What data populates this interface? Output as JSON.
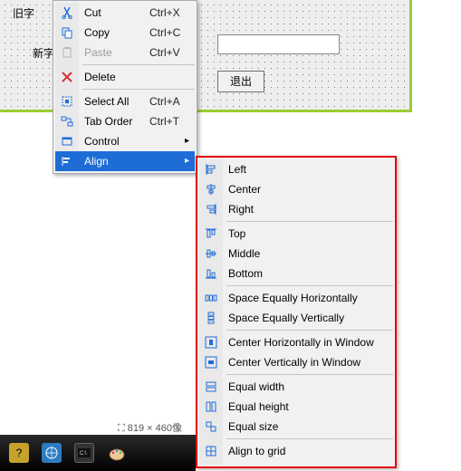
{
  "form": {
    "label_top": "旧字",
    "label_mid": "新字",
    "exit_button": "退出"
  },
  "menu": {
    "cut": {
      "label": "Cut",
      "shortcut": "Ctrl+X"
    },
    "copy": {
      "label": "Copy",
      "shortcut": "Ctrl+C"
    },
    "paste": {
      "label": "Paste",
      "shortcut": "Ctrl+V"
    },
    "delete": {
      "label": "Delete"
    },
    "select_all": {
      "label": "Select All",
      "shortcut": "Ctrl+A"
    },
    "tab_order": {
      "label": "Tab Order",
      "shortcut": "Ctrl+T"
    },
    "control": {
      "label": "Control"
    },
    "align": {
      "label": "Align"
    }
  },
  "align_menu": {
    "left": "Left",
    "center": "Center",
    "right": "Right",
    "top": "Top",
    "middle": "Middle",
    "bottom": "Bottom",
    "space_h": "Space Equally Horizontally",
    "space_v": "Space Equally Vertically",
    "cent_h_win": "Center Horizontally in Window",
    "cent_v_win": "Center Vertically in Window",
    "eq_w": "Equal width",
    "eq_h": "Equal height",
    "eq_s": "Equal size",
    "grid": "Align to grid"
  },
  "status": {
    "dims": "819 × 460像"
  },
  "chart_data": null
}
